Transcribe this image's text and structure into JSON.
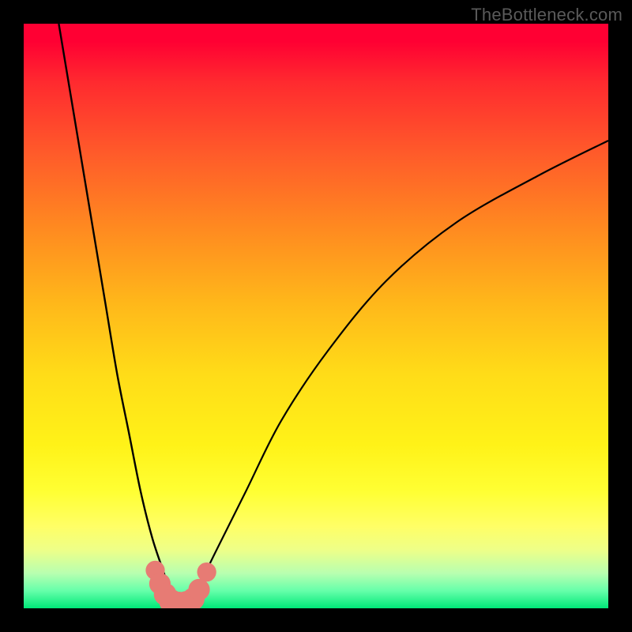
{
  "watermark": {
    "text": "TheBottleneck.com"
  },
  "chart_data": {
    "type": "line",
    "title": "",
    "xlabel": "",
    "ylabel": "",
    "xlim": [
      0,
      100
    ],
    "ylim": [
      0,
      100
    ],
    "background_gradient": {
      "top": "#ff0033",
      "mid": "#ffe018",
      "bottom": "#00e878"
    },
    "series": [
      {
        "name": "left-curve",
        "x": [
          6,
          8,
          10,
          12,
          14,
          16,
          18,
          20,
          22,
          24,
          25,
          26
        ],
        "y": [
          100,
          88,
          76,
          64,
          52,
          40,
          30,
          20,
          12,
          6,
          3,
          1
        ]
      },
      {
        "name": "right-curve",
        "x": [
          28,
          30,
          33,
          38,
          44,
          52,
          62,
          74,
          88,
          100
        ],
        "y": [
          1,
          4,
          10,
          20,
          32,
          44,
          56,
          66,
          74,
          80
        ]
      },
      {
        "name": "valley-floor",
        "x": [
          25,
          26,
          27,
          28,
          29
        ],
        "y": [
          1,
          0.5,
          0.5,
          0.5,
          1
        ]
      }
    ],
    "markers": {
      "name": "valley-markers",
      "color": "#e77b74",
      "points": [
        {
          "x": 22.5,
          "y": 6.5,
          "r": 1.1
        },
        {
          "x": 23.3,
          "y": 4.2,
          "r": 1.3
        },
        {
          "x": 24.2,
          "y": 2.4,
          "r": 1.4
        },
        {
          "x": 25.2,
          "y": 1.2,
          "r": 1.5
        },
        {
          "x": 26.5,
          "y": 0.8,
          "r": 1.5
        },
        {
          "x": 27.8,
          "y": 0.9,
          "r": 1.5
        },
        {
          "x": 29.0,
          "y": 1.6,
          "r": 1.4
        },
        {
          "x": 30.0,
          "y": 3.2,
          "r": 1.3
        },
        {
          "x": 31.3,
          "y": 6.2,
          "r": 1.1
        }
      ]
    }
  }
}
